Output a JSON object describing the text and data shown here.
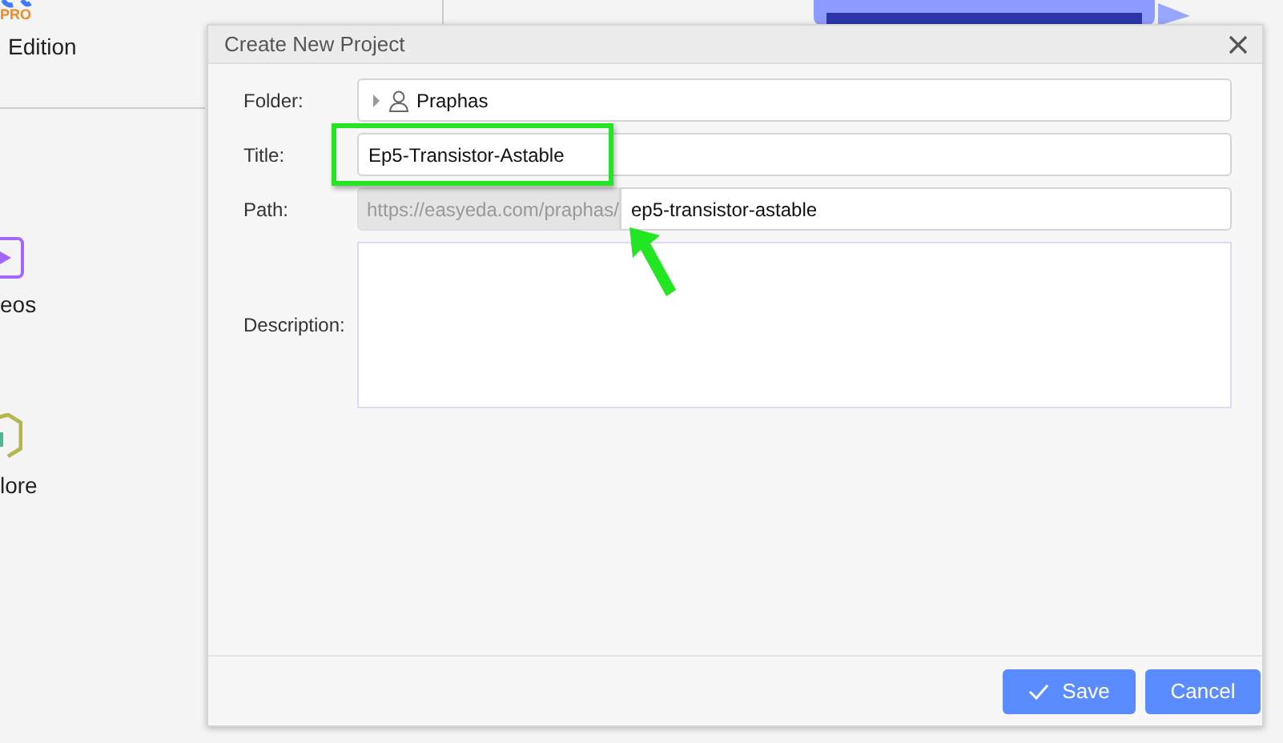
{
  "sidebar": {
    "logo_badge": "PRO",
    "edition": "Edition",
    "items": [
      {
        "kind": "play",
        "label": "eos"
      },
      {
        "kind": "hexagon",
        "label": "lore"
      }
    ]
  },
  "dialog": {
    "title": "Create New Project",
    "folder": {
      "label": "Folder:",
      "value": "Praphas"
    },
    "title_field": {
      "label": "Title:",
      "value": "Ep5-Transistor-Astable"
    },
    "path": {
      "label": "Path:",
      "prefix": "https://easyeda.com/praphas/",
      "value": "ep5-transistor-astable"
    },
    "description": {
      "label": "Description:"
    },
    "buttons": [
      {
        "kind": "save",
        "label": "Save"
      },
      {
        "kind": "cancel",
        "label": "Cancel"
      }
    ]
  }
}
